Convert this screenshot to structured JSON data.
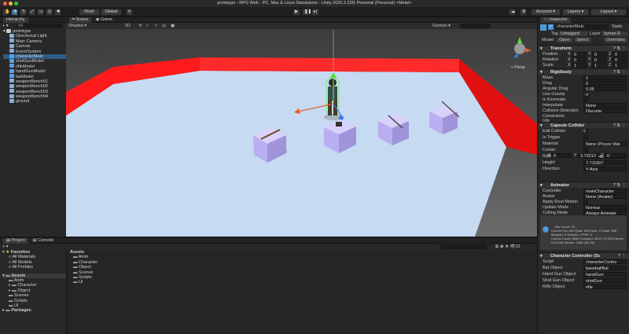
{
  "window": {
    "title": "prototype - RPG Web - PC, Mac & Linux Standalone - Unity 2020.3.23f1 Personal (Personal) <Metal>"
  },
  "toolbar": {
    "pivot": "Pivot",
    "global": "Global",
    "account": "Account",
    "layers": "Layers",
    "layout": "Layout"
  },
  "hierarchy": {
    "tab": "Hierarchy",
    "search_placeholder": "All",
    "scene": "prototype",
    "items": [
      "Directional Light",
      "Main Camera",
      "Canvas",
      "EventSystem",
      "characterMain",
      "shotGunModel",
      "rifleModel",
      "handGunModel",
      "batModel",
      "weaponBench01",
      "weaponBench02",
      "weaponBench03",
      "weaponBench04",
      "ground"
    ]
  },
  "scene": {
    "tab_scene": "Scene",
    "tab_game": "Game",
    "shading": "Shaded",
    "mode": "2D",
    "gizmos": "Gizmos",
    "persp": "< Persp"
  },
  "project": {
    "tab_project": "Project",
    "tab_console": "Console",
    "favorites": "Favorites",
    "fav_items": [
      "All Materials",
      "All Models",
      "All Prefabs"
    ],
    "assets": "Assets",
    "asset_folders": [
      "Anim",
      "Character",
      "Object",
      "Scenes",
      "Scripts",
      "UI"
    ],
    "packages": "Packages",
    "breadcrumb": "Assets",
    "grid_folders": [
      "Anim",
      "Character",
      "Object",
      "Scenes",
      "Scripts",
      "UI"
    ]
  },
  "inspector": {
    "tab": "Inspector",
    "name": "characterMain",
    "static": "Static",
    "tag_label": "Tag",
    "tag": "Untagged",
    "layer_label": "Layer",
    "layer": "Ignore R",
    "model_label": "Model",
    "open": "Open",
    "select": "Select",
    "overrides": "Overrides",
    "transform": {
      "title": "Transform",
      "position": "Position",
      "rotation": "Rotation",
      "scale": "Scale",
      "pos": [
        "0",
        "0",
        "0"
      ],
      "rot": [
        "0",
        "0",
        "0"
      ],
      "scl": [
        "1",
        "1",
        "1"
      ]
    },
    "rigidbody": {
      "title": "Rigidbody",
      "rows": [
        [
          "Mass",
          "1"
        ],
        [
          "Drag",
          "0"
        ],
        [
          "Angular Drag",
          "0.05"
        ],
        [
          "Use Gravity",
          "✓"
        ],
        [
          "Is Kinematic",
          ""
        ],
        [
          "Interpolate",
          "None"
        ],
        [
          "Collision Detection",
          "Discrete"
        ]
      ],
      "constraints": "Constraints",
      "info": "Info"
    },
    "capsule": {
      "title": "Capsule Collider",
      "rows": [
        [
          "Edit Collider",
          ""
        ],
        [
          "Is Trigger",
          ""
        ],
        [
          "Material",
          "None (Physic Mat"
        ],
        [
          "Center",
          ""
        ],
        [
          "Radius",
          "1.430448"
        ],
        [
          "Height",
          "7.711607"
        ],
        [
          "Direction",
          "Y-Axis"
        ]
      ],
      "center": [
        "0",
        "3.73212",
        "0"
      ]
    },
    "animator": {
      "title": "Animator",
      "rows": [
        [
          "Controller",
          "mainCharacter"
        ],
        [
          "Avatar",
          "None (Avatar)"
        ],
        [
          "Apply Root Motion",
          ""
        ],
        [
          "Update Mode",
          "Normal"
        ],
        [
          "Culling Mode",
          "Always Animate"
        ]
      ],
      "info": "Clip Count: 15\nCurves Pos: 649 Quat: 549 Euler: 0 Scale: 505 Muscles: 0 Generic: 0 PPtr: 0\nCurves Count: 5682 Constant: 4200 (73.9%) Dense: 0 (0.0%) Stream: 1482 (26.1%)"
    },
    "controller": {
      "title": "Character Controller (Sc",
      "rows": [
        [
          "Script",
          "characterContro"
        ],
        [
          "Bat Object",
          "baseballBat"
        ],
        [
          "Hand Gun Object",
          "handGun"
        ],
        [
          "Shot Gun Object",
          "shotGun"
        ],
        [
          "Rifle Object",
          "rifle"
        ]
      ]
    }
  },
  "colors": {
    "selection": "#2c5d87",
    "wall": "#ff1b1b",
    "floor": "#c8dcf4",
    "bench": "#b9aef0"
  }
}
